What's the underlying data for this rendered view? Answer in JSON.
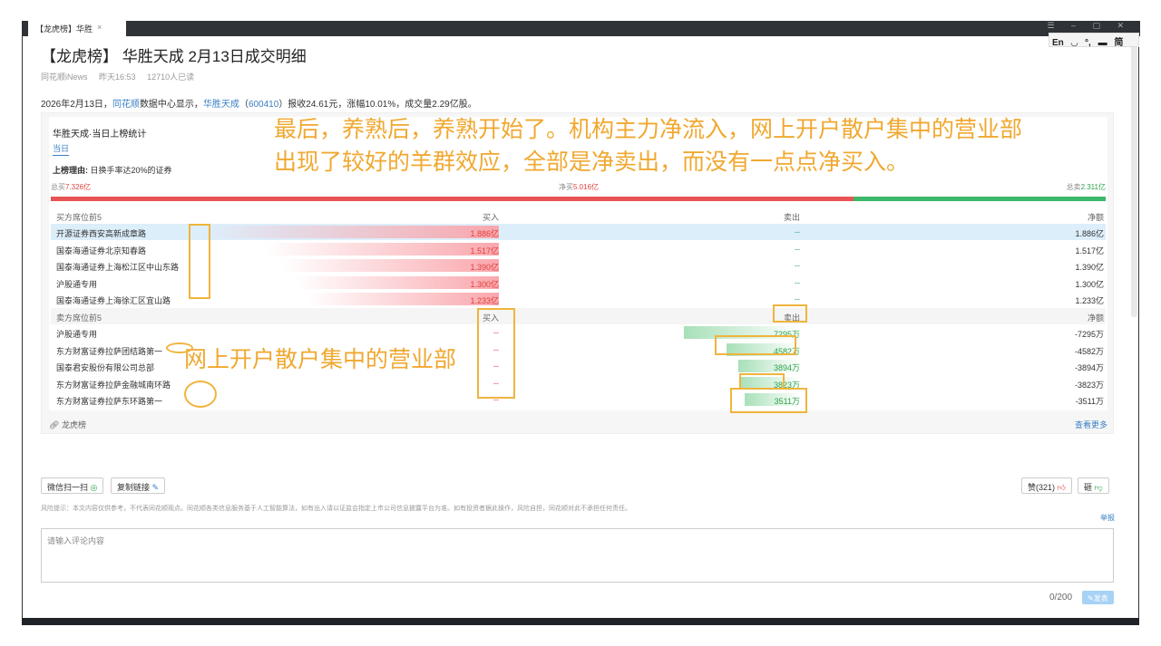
{
  "window": {
    "tab_label": "【龙虎榜】华胜",
    "tab_close": "×",
    "controls": "☰ – ▢ ✕"
  },
  "ime": {
    "lang": "En",
    "icon1": "◡",
    "icon2": "°,",
    "keyboard": "▬",
    "mode": "简"
  },
  "article": {
    "title": "【龙虎榜】 华胜天成 2月13日成交明细",
    "source": "同花顺iNews",
    "time": "昨天16:53",
    "reads": "12710人已读",
    "intro_prefix": "2026年2月13日，",
    "intro_link1": "同花顺",
    "intro_mid": "数据中心显示，",
    "intro_link2": "华胜天成",
    "intro_code_open": "（",
    "intro_code": "600410",
    "intro_suffix": "）报收24.61元，涨幅10.01%，成交量2.29亿股。"
  },
  "panel": {
    "title": "华胜天成·当日上榜统计",
    "tab": "当日",
    "reason_label": "上榜理由:",
    "reason": " 日换手率达20%的证券",
    "total_buy_label": "总买",
    "total_buy": "7.326亿",
    "net_buy_label": "净买",
    "net_buy": "5.016亿",
    "total_sell_label": "总卖",
    "total_sell": "2.311亿",
    "buy_ratio": 0.76,
    "buy_header": {
      "name": "买方席位前5",
      "buy": "买入",
      "sell": "卖出",
      "net": "净额"
    },
    "buy_rows": [
      {
        "name": "开源证券西安高新成章路",
        "buy": "1.886亿",
        "sell": "--",
        "net": "1.886亿",
        "bar": 1.0
      },
      {
        "name": "国泰海通证券北京知春路",
        "buy": "1.517亿",
        "sell": "--",
        "net": "1.517亿",
        "bar": 0.8
      },
      {
        "name": "国泰海通证券上海松江区中山东路",
        "buy": "1.390亿",
        "sell": "--",
        "net": "1.390亿",
        "bar": 0.74
      },
      {
        "name": "沪股通专用",
        "buy": "1.300亿",
        "sell": "--",
        "net": "1.300亿",
        "bar": 0.69
      },
      {
        "name": "国泰海通证券上海徐汇区宜山路",
        "buy": "1.233亿",
        "sell": "--",
        "net": "1.233亿",
        "bar": 0.65
      }
    ],
    "sell_header": {
      "name": "卖方席位前5",
      "buy": "买入",
      "sell": "卖出",
      "net": "净额"
    },
    "sell_rows": [
      {
        "name": "沪股通专用",
        "buy": "--",
        "sell": "7295万",
        "net": "-7295万",
        "bar": 1.0
      },
      {
        "name": "东方财富证券拉萨团结路第一",
        "buy": "--",
        "sell": "4582万",
        "net": "-4582万",
        "bar": 0.63
      },
      {
        "name": "国泰君安股份有限公司总部",
        "buy": "--",
        "sell": "3894万",
        "net": "-3894万",
        "bar": 0.53
      },
      {
        "name": "东方财富证券拉萨金融城南环路",
        "buy": "--",
        "sell": "3823万",
        "net": "-3823万",
        "bar": 0.52
      },
      {
        "name": "东方财富证券拉萨东环路第一",
        "buy": "--",
        "sell": "3511万",
        "net": "-3511万",
        "bar": 0.48
      }
    ],
    "footer": "龙虎榜",
    "more": "查看更多"
  },
  "annotations": {
    "top_line1": "最后，养熟后，养熟开始了。机构主力净流入，网上开户散户集中的营业部",
    "top_line2": "出现了较好的羊群效应，全部是净卖出，而没有一点点净买入。",
    "side": "网上开户散户集中的营业部",
    "color": "#f0a830"
  },
  "actions": {
    "wechat": "微信扫一扫",
    "copy": "复制链接",
    "like": "赞(321)",
    "dislike": "砸"
  },
  "risk": "风险提示：本文内容仅供参考，不代表同花顺观点。同花顺各类信息服务基于人工智能算法，如有出入请以证监会指定上市公司信息披露平台为准。如有投资者据此操作，风险自担，同花顺对此不承担任何责任。",
  "report": "举报",
  "comment": {
    "placeholder": "请输入评论内容",
    "count": "0/200",
    "send": "发表"
  }
}
